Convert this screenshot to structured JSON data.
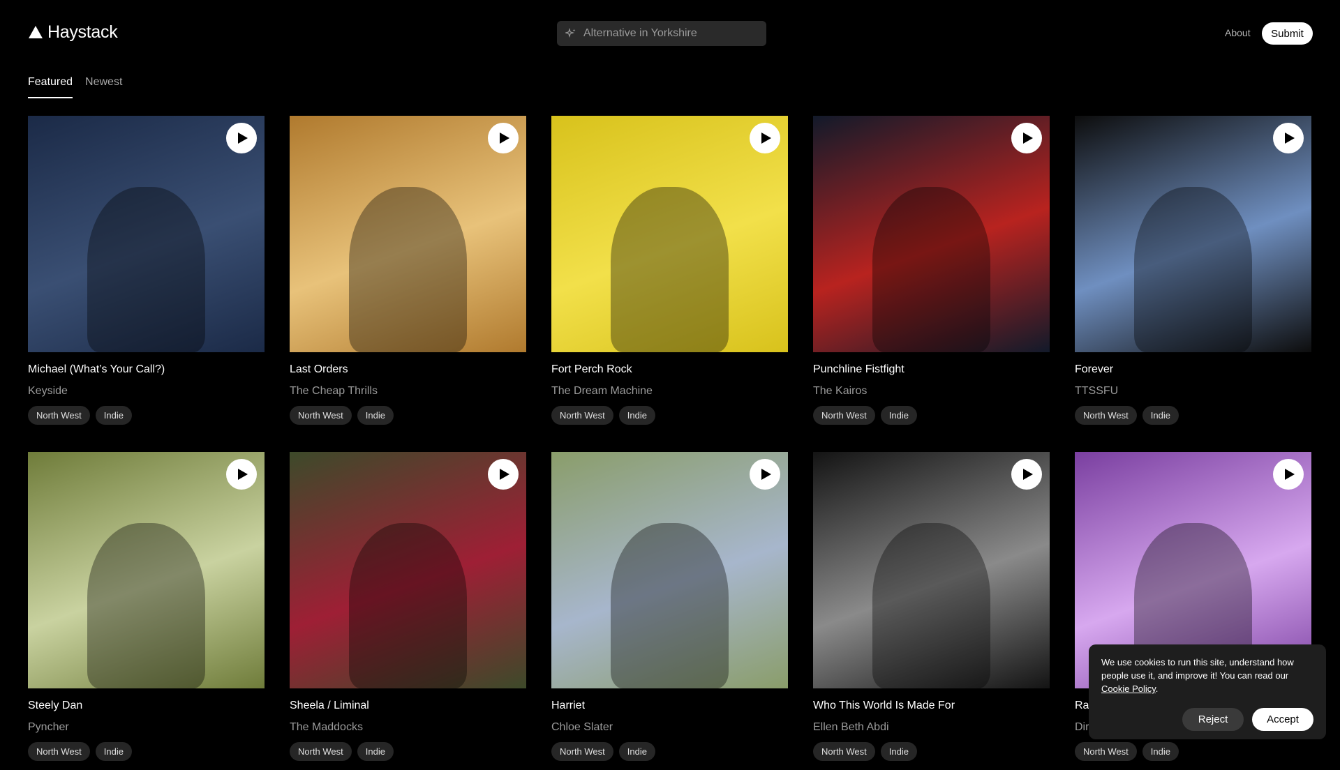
{
  "header": {
    "logo_text": "Haystack",
    "search_placeholder": "Alternative in Yorkshire",
    "about_label": "About",
    "submit_label": "Submit"
  },
  "tabs": [
    {
      "label": "Featured",
      "active": true
    },
    {
      "label": "Newest",
      "active": false
    }
  ],
  "tracks": [
    {
      "title": "Michael (What’s Your Call?)",
      "artist": "Keyside",
      "tags": [
        "North West",
        "Indie"
      ],
      "thumb_colors": [
        "#1b2a47",
        "#3a4f73"
      ]
    },
    {
      "title": "Last Orders",
      "artist": "The Cheap Thrills",
      "tags": [
        "North West",
        "Indie"
      ],
      "thumb_colors": [
        "#b07a2e",
        "#e8c27a"
      ]
    },
    {
      "title": "Fort Perch Rock",
      "artist": "The Dream Machine",
      "tags": [
        "North West",
        "Indie"
      ],
      "thumb_colors": [
        "#d8c21c",
        "#f2e04a"
      ]
    },
    {
      "title": "Punchline Fistfight",
      "artist": "The Kairos",
      "tags": [
        "North West",
        "Indie"
      ],
      "thumb_colors": [
        "#121a2a",
        "#b8231f"
      ]
    },
    {
      "title": "Forever",
      "artist": "TTSSFU",
      "tags": [
        "North West",
        "Indie"
      ],
      "thumb_colors": [
        "#0d0d0d",
        "#6f8fc0"
      ]
    },
    {
      "title": "Steely Dan",
      "artist": "Pyncher",
      "tags": [
        "North West",
        "Indie"
      ],
      "thumb_colors": [
        "#6f7c3a",
        "#c9d2a0"
      ]
    },
    {
      "title": "Sheela / Liminal",
      "artist": "The Maddocks",
      "tags": [
        "North West",
        "Indie"
      ],
      "thumb_colors": [
        "#3d4a2a",
        "#9e1f35"
      ]
    },
    {
      "title": "Harriet",
      "artist": "Chloe Slater",
      "tags": [
        "North West",
        "Indie"
      ],
      "thumb_colors": [
        "#8a9d6a",
        "#a7b6cc"
      ]
    },
    {
      "title": "Who This World Is Made For",
      "artist": "Ellen Beth Abdi",
      "tags": [
        "North West",
        "Indie"
      ],
      "thumb_colors": [
        "#141414",
        "#8a8a8a"
      ]
    },
    {
      "title": "Ra",
      "artist": "Dir",
      "tags": [
        "North West",
        "Indie"
      ],
      "thumb_colors": [
        "#7a3fa0",
        "#d7a8ef"
      ]
    }
  ],
  "cookie": {
    "text": "We use cookies to run this site, understand how people use it, and improve it! You can read our",
    "link_label": "Cookie Policy",
    "link_suffix": ".",
    "reject_label": "Reject",
    "accept_label": "Accept"
  }
}
